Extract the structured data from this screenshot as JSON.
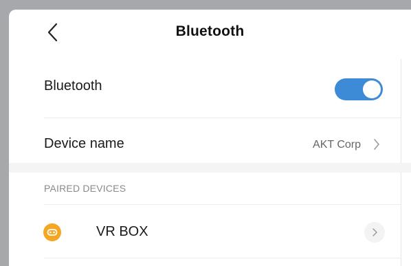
{
  "header": {
    "title": "Bluetooth",
    "back_icon": "back-arrow-icon"
  },
  "settings": {
    "bluetooth": {
      "label": "Bluetooth",
      "enabled": true,
      "toggle_color": "#3d8ad6"
    },
    "device_name": {
      "label": "Device name",
      "value": "AKT Corp"
    }
  },
  "paired": {
    "section_title": "PAIRED DEVICES",
    "devices": [
      {
        "name": "VR BOX",
        "icon": "vr-headset-icon",
        "icon_color": "#f5a623"
      }
    ]
  }
}
